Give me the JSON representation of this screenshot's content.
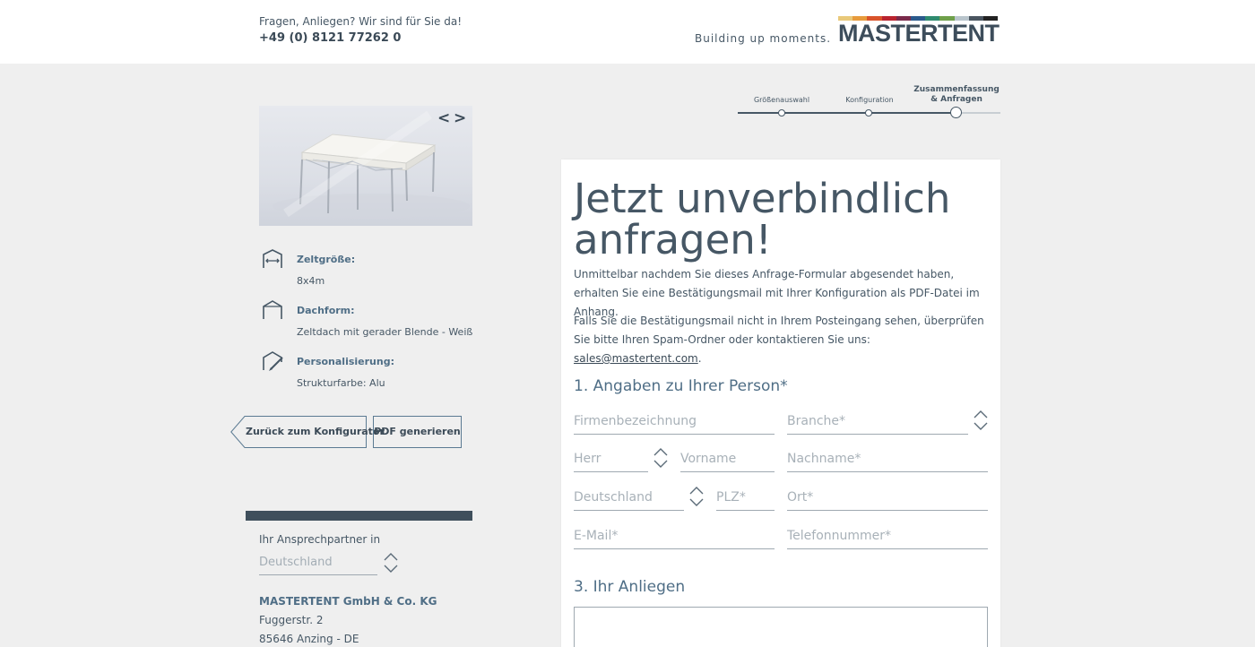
{
  "header": {
    "question": "Fragen, Anliegen? Wir sind für Sie da!",
    "phone": "+49 (0) 8121 77262 0",
    "tagline": "Building up moments.",
    "logo_text": "MASTERTENT",
    "logo_stripe_colors": [
      "#e9c97a",
      "#e79b3c",
      "#d9532b",
      "#b9242f",
      "#7a2a4b",
      "#2b5a8c",
      "#2f8b6f",
      "#6fa04a",
      "#b9c5cc",
      "#4a5560",
      "#222222"
    ]
  },
  "steps": [
    {
      "label": "Größenauswahl",
      "active": false
    },
    {
      "label": "Konfiguration",
      "active": false
    },
    {
      "label": "Zusammenfassung & Anfragen",
      "label_line1": "Zusammenfassung",
      "label_line2": "& Anfragen",
      "active": true
    }
  ],
  "gallery": {
    "prev": "<",
    "next": ">"
  },
  "features": [
    {
      "icon": "tent-size-icon",
      "label": "Zeltgröße:",
      "value": "8x4m"
    },
    {
      "icon": "roof-shape-icon",
      "label": "Dachform:",
      "value": "Zeltdach mit gerader Blende - Weiß"
    },
    {
      "icon": "personalization-icon",
      "label": "Personalisierung:",
      "value": "Strukturfarbe: Alu"
    }
  ],
  "buttons": {
    "back": "Zurück zum Konfigurator",
    "pdf": "PDF generieren"
  },
  "contact": {
    "title": "Ihr Ansprechpartner in",
    "country": "Deutschland",
    "company": "MASTERTENT GmbH & Co. KG",
    "street": "Fuggerstr. 2",
    "city": "85646 Anzing - DE"
  },
  "form": {
    "title_line1": "Jetzt unverbindlich",
    "title_line2": "anfragen!",
    "intro": "Unmittelbar nachdem Sie dieses Anfrage-Formular abgesendet haben, erhalten Sie eine Bestätigungsmail mit Ihrer Konfiguration als PDF-Datei im Anhang.",
    "spam_text": "Falls Sie die Bestätigungsmail nicht in Ihrem Posteingang sehen, überprüfen Sie bitte Ihren Spam-Ordner oder kontaktieren Sie uns: ",
    "email": "sales@mastertent.com",
    "email_suffix": ".",
    "section1": "1. Angaben zu Ihrer Person*",
    "section3": "3. Ihr Anliegen",
    "fields": {
      "company": "Firmenbezeichnung",
      "branche": "Branche*",
      "salutation": "Herr",
      "firstname": "Vorname",
      "lastname": "Nachname*",
      "country": "Deutschland",
      "zip": "PLZ*",
      "city": "Ort*",
      "email": "E-Mail*",
      "phone": "Telefonnummer*"
    }
  }
}
